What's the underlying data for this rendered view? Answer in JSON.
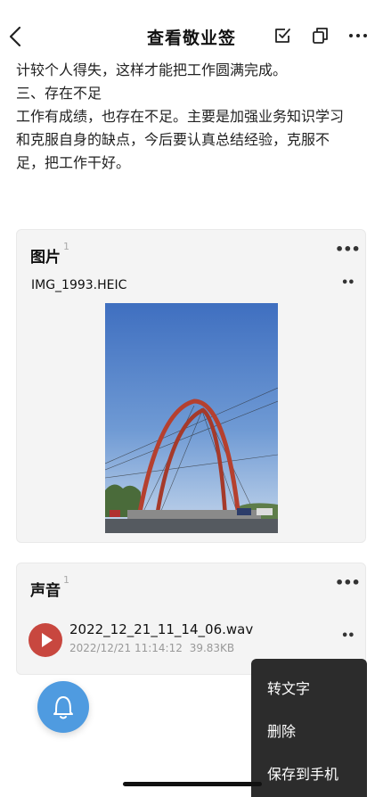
{
  "header": {
    "title": "查看敬业签",
    "back_icon": "chevron-left-icon",
    "check_icon": "checkbox-icon",
    "copy_icon": "copy-icon",
    "more_icon": "more-horizontal-icon"
  },
  "content": {
    "lines": [
      "计较个人得失，这样才能把工作圆满完成。",
      "三、存在不足",
      "工作有成绩，也存在不足。主要是加强业务知识学习",
      "和克服自身的缺点，今后要认真总结经验，克服不",
      "足，把工作干好。"
    ]
  },
  "image_card": {
    "title": "图片",
    "count": "1",
    "more": "•••",
    "file_name": "IMG_1993.HEIC",
    "file_more": "••"
  },
  "audio_card": {
    "title": "声音",
    "count": "1",
    "more": "•••",
    "file_name": "2022_12_21_11_14_06.wav",
    "datetime": "2022/12/21 11:14:12",
    "size": "39.83KB",
    "file_more": "••"
  },
  "context_menu": {
    "items": [
      "转文字",
      "删除",
      "保存到手机"
    ]
  },
  "fab": {
    "icon": "bell-icon"
  },
  "colors": {
    "accent": "#4f9be0",
    "play": "#c8473f",
    "menu_bg": "#2c2c2c"
  }
}
